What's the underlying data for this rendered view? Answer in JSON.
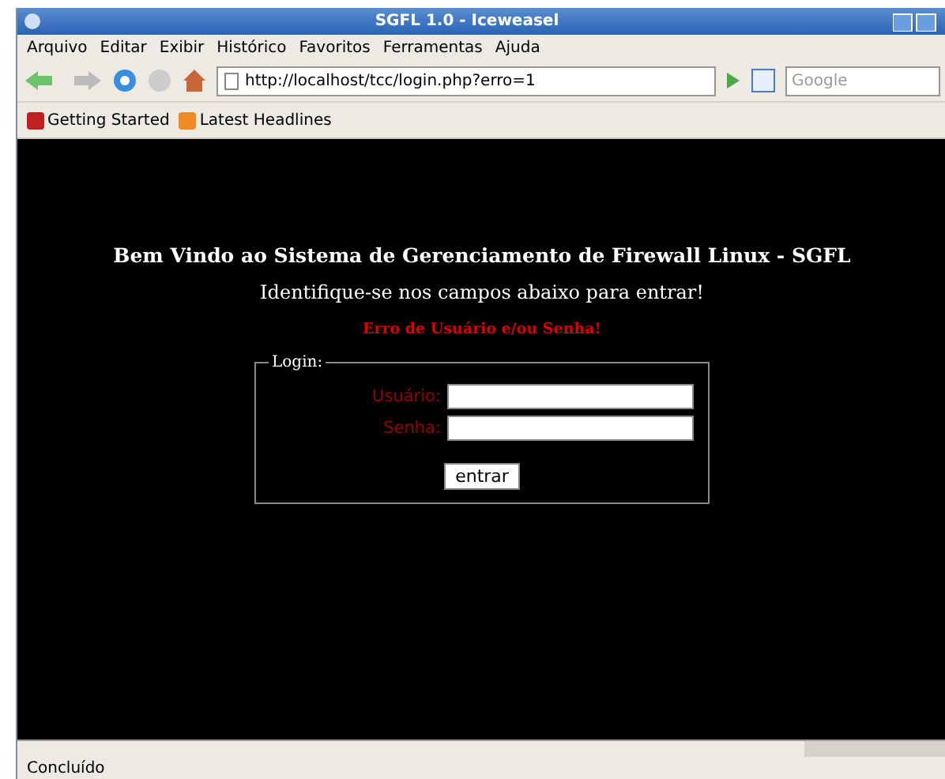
{
  "window": {
    "title": "SGFL 1.0 - Iceweasel"
  },
  "menu": [
    "Arquivo",
    "Editar",
    "Exibir",
    "Histórico",
    "Favoritos",
    "Ferramentas",
    "Ajuda"
  ],
  "address": {
    "value": "http://localhost/tcc/login.php?erro=1"
  },
  "search": {
    "placeholder": "Google"
  },
  "bookmarks": [
    "Getting Started",
    "Latest Headlines"
  ],
  "page": {
    "heading": "Bem Vindo ao Sistema de Gerenciamento de Firewall Linux - SGFL",
    "subheading": "Identifique-se nos campos abaixo para entrar!",
    "error": "Erro de Usuário e/ou Senha!",
    "form": {
      "legend": "Login:",
      "fields": [
        {
          "label": "Usuário:"
        },
        {
          "label": "Senha:"
        }
      ],
      "submit": "entrar"
    }
  },
  "status_bar": "Concluído"
}
